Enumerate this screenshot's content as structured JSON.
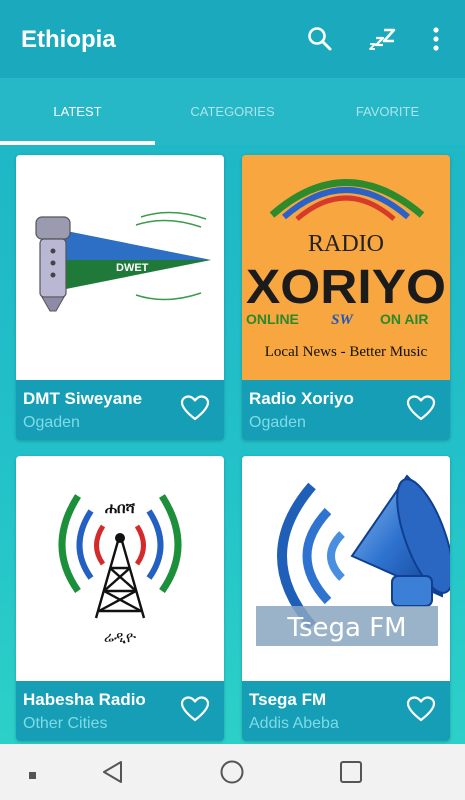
{
  "app": {
    "title": "Ethiopia"
  },
  "toolbar": {
    "icons": [
      "search-icon",
      "sleep-timer-icon",
      "more-vert-icon"
    ]
  },
  "tabs": [
    {
      "label": "LATEST",
      "active": true
    },
    {
      "label": "CATEGORIES",
      "active": false
    },
    {
      "label": "FAVORITE",
      "active": false
    }
  ],
  "stations": [
    {
      "name": "DMT Siweyane",
      "city": "Ogaden",
      "logo_text": "DWET"
    },
    {
      "name": "Radio Xoriyo",
      "city": "Ogaden",
      "logo_lines": [
        "RADIO",
        "XORIYO",
        "ONLINE",
        "SW",
        "ON AIR",
        "Local News - Better Music"
      ]
    },
    {
      "name": "Habesha Radio",
      "city": "Other Cities",
      "logo_lines": [
        "ሐበሻ",
        "ሬዲዮ"
      ]
    },
    {
      "name": "Tsega FM",
      "city": "Addis Abeba",
      "logo_text": "Tsega FM"
    }
  ],
  "colors": {
    "appbar": "#1aa9bd",
    "card_footer": "#169eb6",
    "city_text": "#7fdbe5",
    "navbar": "#f2f2f2"
  },
  "system_nav": [
    "recent-dot-icon",
    "back-icon",
    "home-icon",
    "overview-icon"
  ]
}
